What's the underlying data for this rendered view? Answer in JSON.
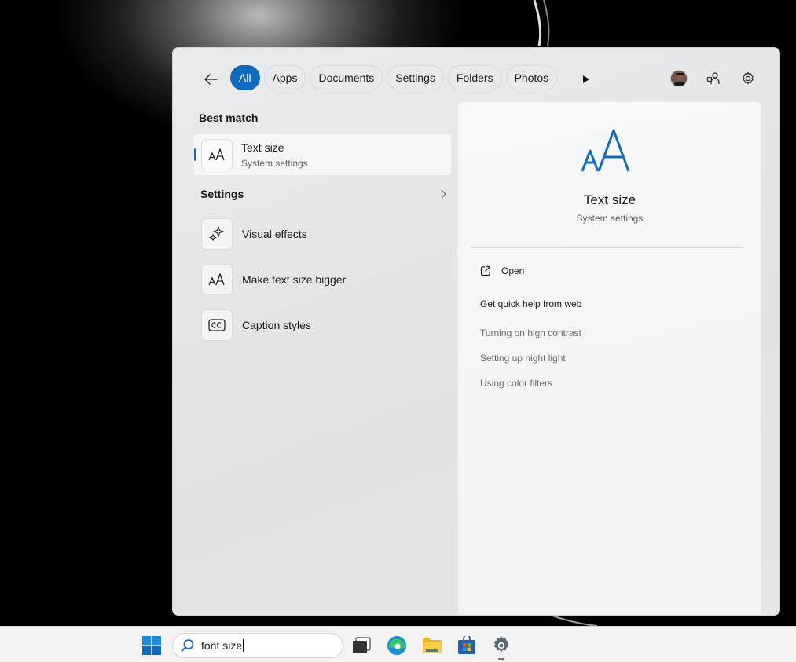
{
  "search_panel": {
    "filters": [
      {
        "label": "All",
        "active": true
      },
      {
        "label": "Apps",
        "active": false
      },
      {
        "label": "Documents",
        "active": false
      },
      {
        "label": "Settings",
        "active": false
      },
      {
        "label": "Folders",
        "active": false
      },
      {
        "label": "Photos",
        "active": false
      }
    ],
    "best_match": {
      "heading": "Best match",
      "title": "Text size",
      "subtitle": "System settings",
      "icon": "text-size-icon"
    },
    "settings_section": {
      "heading": "Settings",
      "items": [
        {
          "label": "Visual effects",
          "icon": "sparkle-icon"
        },
        {
          "label": "Make text size bigger",
          "icon": "text-size-icon"
        },
        {
          "label": "Caption styles",
          "icon": "cc-icon"
        }
      ]
    },
    "preview": {
      "title": "Text size",
      "subtitle": "System settings",
      "open_label": "Open",
      "help_heading": "Get quick help from web",
      "help_links": [
        "Turning on high contrast",
        "Setting up night light",
        "Using color filters"
      ]
    }
  },
  "taskbar": {
    "search_value": "font size",
    "apps": [
      "task-view-icon",
      "edge-icon",
      "file-explorer-icon",
      "microsoft-store-icon",
      "settings-icon"
    ]
  },
  "colors": {
    "accent": "#0f6cbd",
    "panel_bg": "#e4e6e8",
    "preview_bg": "#f5f6f7"
  }
}
